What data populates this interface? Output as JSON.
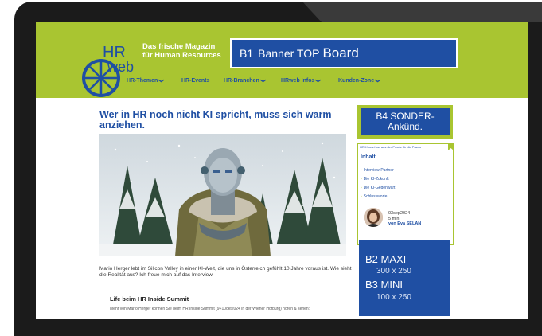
{
  "header": {
    "tagline_line1": "Das frische Magazin",
    "tagline_line2": "für Human Resources",
    "logo_line1": "HR",
    "logo_line2": "web",
    "banner_top": {
      "code": "B1",
      "text_a": "Banner TOP",
      "text_b": "Board"
    }
  },
  "nav": {
    "items": [
      {
        "label": "HR-Themen",
        "dropdown": true
      },
      {
        "label": "HR-Events",
        "dropdown": false
      },
      {
        "label": "HR-Branchen",
        "dropdown": true
      },
      {
        "label": "HRweb Infos",
        "dropdown": true
      },
      {
        "label": "Kunden-Zone",
        "dropdown": true
      }
    ],
    "chevron": "❯"
  },
  "article": {
    "title": "Wer in HR noch nicht KI spricht, muss sich warm anziehen.",
    "intro": "Mario Herger lebt im Silicon Valley in einer KI-Welt, die uns in Österreich gefühlt 10 Jahre voraus ist. Wie sieht die Realität aus? Ich freue mich auf das Interview.",
    "subhead": "Life beim HR Inside Summit",
    "more_text": "Mehr von Mario Herger können Sie beim HR Inside Summit (9+10okt2024 in der Wiener Hofburg) hören & sehen:"
  },
  "sidebar": {
    "b4_line1": "B4 SONDER-",
    "b4_line2": "Ankünd.",
    "toc": {
      "header": "HR-Know-how aus der Praxis für die Praxis",
      "title": "Inhalt",
      "items": [
        "Interview-Partner",
        "Die KI-Zukunft",
        "Die KI-Gegenwart",
        "Schlussworte"
      ],
      "date": "03sep2024",
      "read_time": "5 min",
      "author": "von Eva SELAN"
    },
    "b2": {
      "maxi": "B2 MAXI",
      "maxi_size": "300 x 250",
      "mini": "B3 MINI",
      "mini_size": "100 x 250"
    }
  },
  "colors": {
    "brand_green": "#a9c531",
    "brand_blue": "#1f4fa3",
    "bezel": "#1b1b1b"
  }
}
